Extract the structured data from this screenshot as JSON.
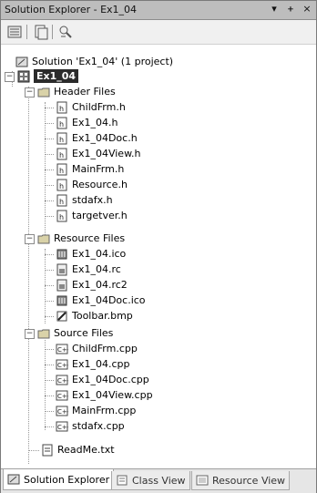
{
  "window": {
    "title": "Solution Explorer - Ex1_04",
    "buttons": {
      "pin": "ᚐ",
      "close": "×"
    }
  },
  "toolbar": {
    "items": [
      "properties-icon",
      "show-all-files-icon",
      "view-class-diagram-icon"
    ]
  },
  "tree": {
    "solution": "Solution 'Ex1_04' (1 project)",
    "project": "Ex1_04",
    "header_folder": "Header Files",
    "header_files": [
      "ChildFrm.h",
      "Ex1_04.h",
      "Ex1_04Doc.h",
      "Ex1_04View.h",
      "MainFrm.h",
      "Resource.h",
      "stdafx.h",
      "targetver.h"
    ],
    "resource_folder": "Resource Files",
    "resource_files": [
      "Ex1_04.ico",
      "Ex1_04.rc",
      "Ex1_04.rc2",
      "Ex1_04Doc.ico",
      "Toolbar.bmp"
    ],
    "source_folder": "Source Files",
    "source_files": [
      "ChildFrm.cpp",
      "Ex1_04.cpp",
      "Ex1_04Doc.cpp",
      "Ex1_04View.cpp",
      "MainFrm.cpp",
      "stdafx.cpp"
    ],
    "readme": "ReadMe.txt"
  },
  "tabs": [
    "Solution Explorer",
    "Class View",
    "Resource View"
  ],
  "colors": {
    "titlebar": "#bdbdbd",
    "selection": "#2b2b2b",
    "folder": "#d9d2a8"
  }
}
